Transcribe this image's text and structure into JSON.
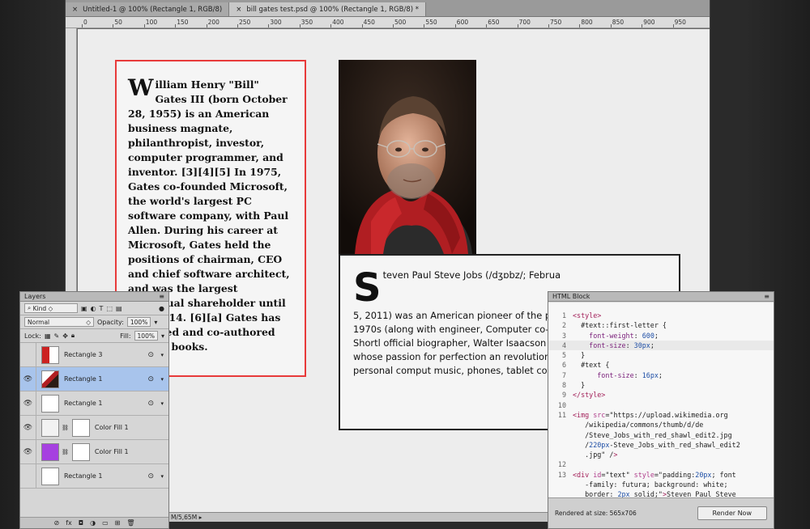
{
  "tabs": [
    {
      "label": "Untitled-1 @ 100% (Rectangle 1, RGB/8)",
      "close": "×"
    },
    {
      "label": "bill gates test.psd @ 100% (Rectangle 1, RGB/8) *",
      "close": "×"
    }
  ],
  "ruler": {
    "ticks": [
      "0",
      "50",
      "100",
      "150",
      "200",
      "250",
      "300",
      "350",
      "400",
      "450",
      "500",
      "550",
      "600",
      "650",
      "700",
      "750",
      "800",
      "850",
      "900",
      "950"
    ]
  },
  "status": {
    "doc_size": "M/5,65M"
  },
  "gates_text": {
    "drop": "W",
    "body": "illiam Henry \"Bill\" Gates III (born October 28, 1955) is an American business magnate, philanthropist, investor, computer programmer, and inventor. [3][4][5] In 1975, Gates co-founded Microsoft, the world's largest PC software company, with Paul Allen. During his career at Microsoft, Gates held the positions of chairman, CEO and chief software architect, and was the largest individual shareholder until May 2014. [6][a] Gates has authored and co-authored several books."
  },
  "jobs_text": {
    "drop": "S",
    "first": "teven Paul Steve Jobs (/dʒɒbz/; Februa",
    "body": "5, 2011) was an American pioneer of the pers revolution of the 1970s (along with engineer, Computer co-founder, Steve Wozniak). Shortl official biographer, Walter Isaacson described entrepreneur whose passion for perfection an revolutionized six industries: personal comput music, phones, tablet computing, and digital p"
  },
  "layers_panel": {
    "title": "Layers",
    "kind": "Kind",
    "blend": "Normal",
    "opacity_label": "Opacity:",
    "opacity": "100%",
    "lock_label": "Lock:",
    "fill_label": "Fill:",
    "fill": "100%",
    "layers": [
      {
        "name": "Rectangle 3",
        "visible": false,
        "selected": false
      },
      {
        "name": "Rectangle 1",
        "visible": true,
        "selected": true
      },
      {
        "name": "Rectangle 1",
        "visible": true,
        "selected": false
      },
      {
        "name": "Color Fill 1",
        "visible": true,
        "selected": false,
        "swatch": "#f2f2f2"
      },
      {
        "name": "Color Fill 1",
        "visible": true,
        "selected": false,
        "swatch": "#a640e0"
      },
      {
        "name": "Rectangle 1",
        "visible": false,
        "selected": false
      }
    ],
    "footer_icons": [
      "link-icon",
      "fx-icon",
      "mask-icon",
      "adjustment-icon",
      "folder-icon",
      "new-layer-icon",
      "trash-icon"
    ]
  },
  "html_block": {
    "title": "HTML Block",
    "rendered": "Rendered at size: 565x706",
    "render_button": "Render Now",
    "lines": [
      {
        "n": "1",
        "t": "<style>"
      },
      {
        "n": "2",
        "t": "  #text::first-letter {"
      },
      {
        "n": "3",
        "t": "    font-weight: 600;"
      },
      {
        "n": "4",
        "t": "    font-size: 30px;"
      },
      {
        "n": "5",
        "t": "  }"
      },
      {
        "n": "6",
        "t": "  #text {"
      },
      {
        "n": "7",
        "t": "      font-size: 16px;"
      },
      {
        "n": "8",
        "t": "  }"
      },
      {
        "n": "9",
        "t": "</style>"
      },
      {
        "n": "10",
        "t": ""
      },
      {
        "n": "11",
        "t": "<img src=\"https://upload.wikimedia.org"
      },
      {
        "n": "",
        "t": "   /wikipedia/commons/thumb/d/de"
      },
      {
        "n": "",
        "t": "   /Steve_Jobs_with_red_shawl_edit2.jpg"
      },
      {
        "n": "",
        "t": "   /220px-Steve_Jobs_with_red_shawl_edit2"
      },
      {
        "n": "",
        "t": "   .jpg\" />"
      },
      {
        "n": "12",
        "t": ""
      },
      {
        "n": "13",
        "t": "<div id=\"text\" style=\"padding:20px; font"
      },
      {
        "n": "",
        "t": "   -family: futura; background: white;"
      },
      {
        "n": "",
        "t": "   border: 2px solid;\">Steven Paul Steve"
      }
    ]
  }
}
